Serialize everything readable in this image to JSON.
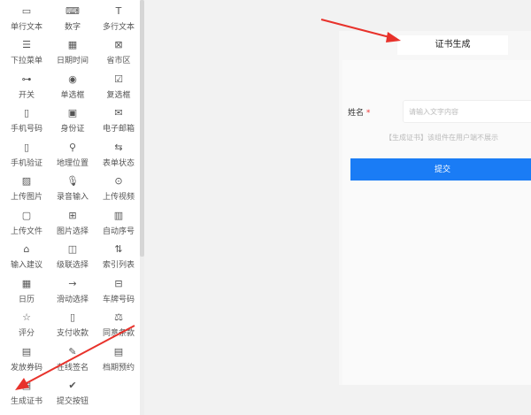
{
  "components": [
    {
      "label": "单行文本",
      "icon": "▭"
    },
    {
      "label": "数字",
      "icon": "⌨"
    },
    {
      "label": "多行文本",
      "icon": "T"
    },
    {
      "label": "下拉菜单",
      "icon": "☰"
    },
    {
      "label": "日期时间",
      "icon": "▦"
    },
    {
      "label": "省市区",
      "icon": "⊠"
    },
    {
      "label": "开关",
      "icon": "⊶"
    },
    {
      "label": "单选框",
      "icon": "◉"
    },
    {
      "label": "复选框",
      "icon": "☑"
    },
    {
      "label": "手机号码",
      "icon": "▯"
    },
    {
      "label": "身份证",
      "icon": "▣"
    },
    {
      "label": "电子邮箱",
      "icon": "✉"
    },
    {
      "label": "手机验证",
      "icon": "▯"
    },
    {
      "label": "地理位置",
      "icon": "⚲"
    },
    {
      "label": "表单状态",
      "icon": "⇆"
    },
    {
      "label": "上传图片",
      "icon": "▨"
    },
    {
      "label": "录音输入",
      "icon": "🎙"
    },
    {
      "label": "上传视频",
      "icon": "⊙"
    },
    {
      "label": "上传文件",
      "icon": "▢"
    },
    {
      "label": "图片选择",
      "icon": "⊞"
    },
    {
      "label": "自动序号",
      "icon": "▥"
    },
    {
      "label": "输入建议",
      "icon": "⌂"
    },
    {
      "label": "级联选择",
      "icon": "◫"
    },
    {
      "label": "索引列表",
      "icon": "⇅"
    },
    {
      "label": "日历",
      "icon": "▦"
    },
    {
      "label": "滑动选择",
      "icon": "→"
    },
    {
      "label": "车牌号码",
      "icon": "⊟"
    },
    {
      "label": "评分",
      "icon": "☆"
    },
    {
      "label": "支付收款",
      "icon": "▯"
    },
    {
      "label": "同意条款",
      "icon": "⚖"
    },
    {
      "label": "发放券码",
      "icon": "▤"
    },
    {
      "label": "在线签名",
      "icon": "✎"
    },
    {
      "label": "档期预约",
      "icon": "▤"
    },
    {
      "label": "生成证书",
      "icon": "▤"
    },
    {
      "label": "提交按钮",
      "icon": "✔"
    }
  ],
  "preview": {
    "title": "证书生成",
    "field_label": "姓名",
    "required_mark": "*",
    "placeholder": "请输入文字内容",
    "hint": "【生成证书】该组件在用户端不展示",
    "submit_label": "提交"
  },
  "colors": {
    "accent": "#1a7cf5",
    "arrow": "#e8322b"
  }
}
